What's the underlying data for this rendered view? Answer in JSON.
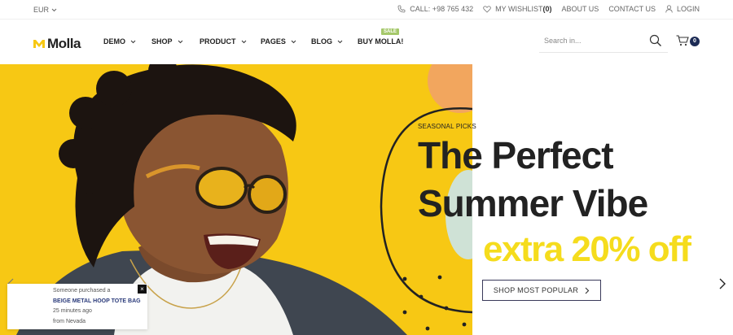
{
  "topbar": {
    "currency": "EUR",
    "call": "CALL: +98 765 432",
    "wishlist_label": "MY WISHLIST",
    "wishlist_count": "(0)",
    "about": "ABOUT US",
    "contact": "CONTACT US",
    "login": "LOGIN"
  },
  "header": {
    "logo": "Molla",
    "nav": [
      {
        "label": "DEMO"
      },
      {
        "label": "SHOP"
      },
      {
        "label": "PRODUCT"
      },
      {
        "label": "PAGES"
      },
      {
        "label": "BLOG"
      },
      {
        "label": "BUY MOLLA!",
        "badge": "SALE"
      }
    ],
    "search_placeholder": "Search in...",
    "cart_count": "0"
  },
  "hero": {
    "eyebrow": "SEASONAL PICKS",
    "title_line1": "The Perfect",
    "title_line2": "Summer Vibe",
    "offer": "extra 20% off",
    "cta": "SHOP MOST POPULAR"
  },
  "toast": {
    "line1": "Someone purchased a",
    "product": "BEIGE METAL HOOP TOTE BAG",
    "time": "25 minutes ago",
    "location": "from Nevada",
    "close": "×"
  },
  "colors": {
    "accent_yellow": "#f7c814",
    "offer_yellow": "#f5dc1d",
    "badge_green": "#a5c86b",
    "navy": "#1c2b55"
  }
}
